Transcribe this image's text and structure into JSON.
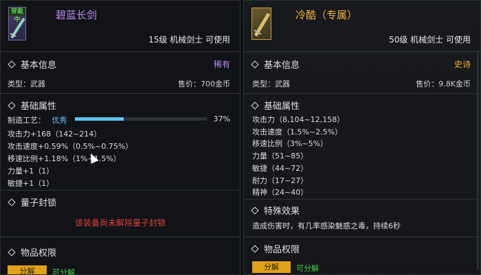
{
  "left": {
    "equipped_tag": "穿戴中",
    "item_name": "碧蓝长剑",
    "requirement": "15级 机械剑士 可使用",
    "basic_info": {
      "title": "基本信息",
      "rarity": "稀有",
      "type": "类型：武器",
      "price": "售价：700金币"
    },
    "attributes": {
      "title": "基础属性",
      "craft_label": "制造工艺：",
      "craft_quality": "优秀",
      "craft_percent_text": "37%",
      "craft_progress": 0.37,
      "stats": [
        "攻击力+168（142~214）",
        "攻击速度+0.59%（0.5%~0.75%）",
        "移速比例+1.18%（1%~1.5%）",
        "力量+1（1）",
        "敏捷+1（1）"
      ]
    },
    "quantum_lock": {
      "title": "量子封锁",
      "message": "该装备尚未解除量子封锁"
    },
    "permission": {
      "title": "物品权限",
      "badge": "分解",
      "can": "可分解"
    }
  },
  "right": {
    "item_name": "冷酷（专属）",
    "requirement": "50级 机械剑士 可使用",
    "basic_info": {
      "title": "基本信息",
      "rarity": "史诗",
      "type": "类型：武器",
      "price": "售价：9.8K金币"
    },
    "attributes": {
      "title": "基础属性",
      "stats": [
        "攻击力（8,104~12,158）",
        "攻击速度（1.5%~2.5%）",
        "移速比例（3%~5%）",
        "力量（51~85）",
        "敏捷（44~72）",
        "耐力（17~27）",
        "精神（24~40）"
      ]
    },
    "special": {
      "title": "特殊效果",
      "text": "造成伤害时，有几率感染魅惑之毒，持续6秒"
    },
    "permission": {
      "title": "物品权限",
      "badge": "分解",
      "can": "可分解"
    }
  },
  "colors": {
    "rare": "#b78ef0",
    "epic": "#f0b040",
    "lock": "#d94040",
    "green": "#4ccf4c",
    "badge": "#e0a21a"
  }
}
